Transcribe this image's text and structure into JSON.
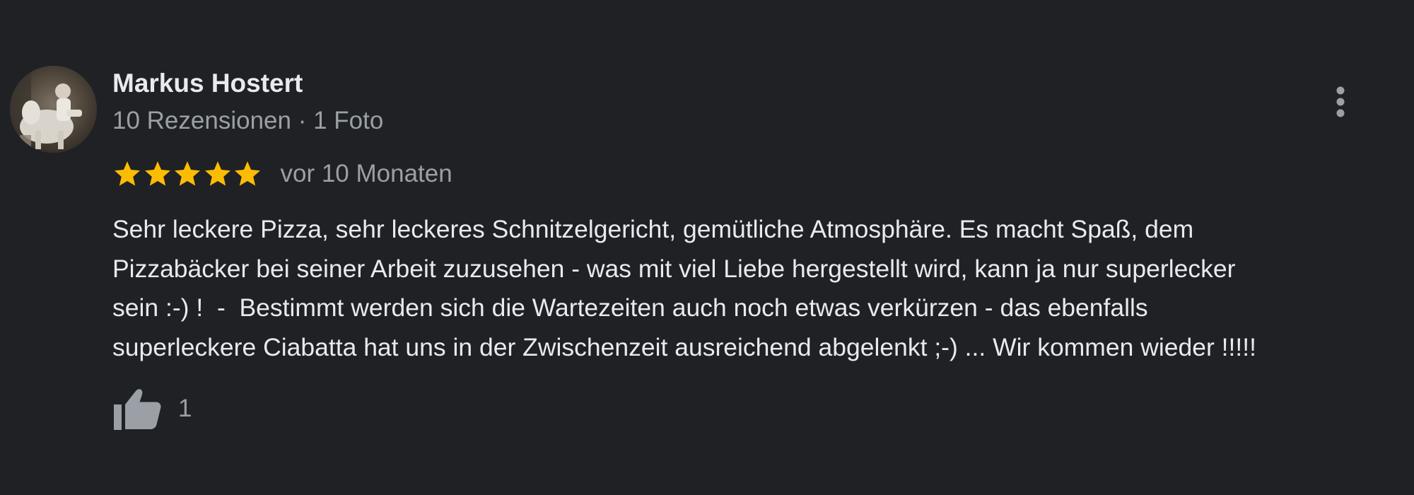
{
  "review": {
    "author": {
      "name": "Markus Hostert",
      "meta": "10 Rezensionen · 1 Foto",
      "avatar_icon": "profile-photo"
    },
    "rating": 5,
    "rating_max": 5,
    "date": "vor 10 Monaten",
    "text": "Sehr leckere Pizza, sehr leckeres Schnitzelgericht, gemütliche Atmosphäre. Es macht Spaß, dem\nPizzabäcker bei seiner Arbeit zuzusehen - was mit viel Liebe hergestellt wird, kann ja nur superlecker\nsein :-) !  -  Bestimmt werden sich die Wartezeiten auch noch etwas verkürzen - das ebenfalls\nsuperleckere Ciabatta hat uns in der Zwischenzeit ausreichend abgelenkt ;-) ... Wir kommen wieder !!!!!",
    "likes": "1"
  },
  "icons": {
    "more": "more-vert-icon",
    "star": "star-icon",
    "like": "thumb-up-icon"
  },
  "colors": {
    "background": "#202124",
    "text_primary": "#e8eaed",
    "text_secondary": "#9aa0a6",
    "star": "#fbbc04"
  }
}
